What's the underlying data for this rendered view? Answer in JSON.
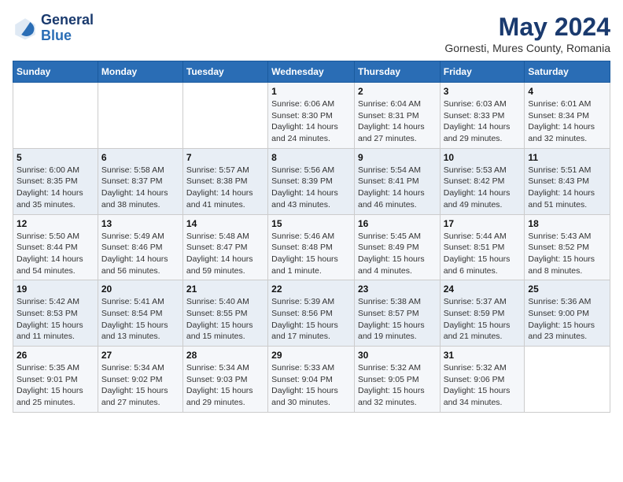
{
  "header": {
    "logo_line1": "General",
    "logo_line2": "Blue",
    "title": "May 2024",
    "subtitle": "Gornesti, Mures County, Romania"
  },
  "weekdays": [
    "Sunday",
    "Monday",
    "Tuesday",
    "Wednesday",
    "Thursday",
    "Friday",
    "Saturday"
  ],
  "weeks": [
    [
      {
        "day": "",
        "detail": ""
      },
      {
        "day": "",
        "detail": ""
      },
      {
        "day": "",
        "detail": ""
      },
      {
        "day": "1",
        "detail": "Sunrise: 6:06 AM\nSunset: 8:30 PM\nDaylight: 14 hours\nand 24 minutes."
      },
      {
        "day": "2",
        "detail": "Sunrise: 6:04 AM\nSunset: 8:31 PM\nDaylight: 14 hours\nand 27 minutes."
      },
      {
        "day": "3",
        "detail": "Sunrise: 6:03 AM\nSunset: 8:33 PM\nDaylight: 14 hours\nand 29 minutes."
      },
      {
        "day": "4",
        "detail": "Sunrise: 6:01 AM\nSunset: 8:34 PM\nDaylight: 14 hours\nand 32 minutes."
      }
    ],
    [
      {
        "day": "5",
        "detail": "Sunrise: 6:00 AM\nSunset: 8:35 PM\nDaylight: 14 hours\nand 35 minutes."
      },
      {
        "day": "6",
        "detail": "Sunrise: 5:58 AM\nSunset: 8:37 PM\nDaylight: 14 hours\nand 38 minutes."
      },
      {
        "day": "7",
        "detail": "Sunrise: 5:57 AM\nSunset: 8:38 PM\nDaylight: 14 hours\nand 41 minutes."
      },
      {
        "day": "8",
        "detail": "Sunrise: 5:56 AM\nSunset: 8:39 PM\nDaylight: 14 hours\nand 43 minutes."
      },
      {
        "day": "9",
        "detail": "Sunrise: 5:54 AM\nSunset: 8:41 PM\nDaylight: 14 hours\nand 46 minutes."
      },
      {
        "day": "10",
        "detail": "Sunrise: 5:53 AM\nSunset: 8:42 PM\nDaylight: 14 hours\nand 49 minutes."
      },
      {
        "day": "11",
        "detail": "Sunrise: 5:51 AM\nSunset: 8:43 PM\nDaylight: 14 hours\nand 51 minutes."
      }
    ],
    [
      {
        "day": "12",
        "detail": "Sunrise: 5:50 AM\nSunset: 8:44 PM\nDaylight: 14 hours\nand 54 minutes."
      },
      {
        "day": "13",
        "detail": "Sunrise: 5:49 AM\nSunset: 8:46 PM\nDaylight: 14 hours\nand 56 minutes."
      },
      {
        "day": "14",
        "detail": "Sunrise: 5:48 AM\nSunset: 8:47 PM\nDaylight: 14 hours\nand 59 minutes."
      },
      {
        "day": "15",
        "detail": "Sunrise: 5:46 AM\nSunset: 8:48 PM\nDaylight: 15 hours\nand 1 minute."
      },
      {
        "day": "16",
        "detail": "Sunrise: 5:45 AM\nSunset: 8:49 PM\nDaylight: 15 hours\nand 4 minutes."
      },
      {
        "day": "17",
        "detail": "Sunrise: 5:44 AM\nSunset: 8:51 PM\nDaylight: 15 hours\nand 6 minutes."
      },
      {
        "day": "18",
        "detail": "Sunrise: 5:43 AM\nSunset: 8:52 PM\nDaylight: 15 hours\nand 8 minutes."
      }
    ],
    [
      {
        "day": "19",
        "detail": "Sunrise: 5:42 AM\nSunset: 8:53 PM\nDaylight: 15 hours\nand 11 minutes."
      },
      {
        "day": "20",
        "detail": "Sunrise: 5:41 AM\nSunset: 8:54 PM\nDaylight: 15 hours\nand 13 minutes."
      },
      {
        "day": "21",
        "detail": "Sunrise: 5:40 AM\nSunset: 8:55 PM\nDaylight: 15 hours\nand 15 minutes."
      },
      {
        "day": "22",
        "detail": "Sunrise: 5:39 AM\nSunset: 8:56 PM\nDaylight: 15 hours\nand 17 minutes."
      },
      {
        "day": "23",
        "detail": "Sunrise: 5:38 AM\nSunset: 8:57 PM\nDaylight: 15 hours\nand 19 minutes."
      },
      {
        "day": "24",
        "detail": "Sunrise: 5:37 AM\nSunset: 8:59 PM\nDaylight: 15 hours\nand 21 minutes."
      },
      {
        "day": "25",
        "detail": "Sunrise: 5:36 AM\nSunset: 9:00 PM\nDaylight: 15 hours\nand 23 minutes."
      }
    ],
    [
      {
        "day": "26",
        "detail": "Sunrise: 5:35 AM\nSunset: 9:01 PM\nDaylight: 15 hours\nand 25 minutes."
      },
      {
        "day": "27",
        "detail": "Sunrise: 5:34 AM\nSunset: 9:02 PM\nDaylight: 15 hours\nand 27 minutes."
      },
      {
        "day": "28",
        "detail": "Sunrise: 5:34 AM\nSunset: 9:03 PM\nDaylight: 15 hours\nand 29 minutes."
      },
      {
        "day": "29",
        "detail": "Sunrise: 5:33 AM\nSunset: 9:04 PM\nDaylight: 15 hours\nand 30 minutes."
      },
      {
        "day": "30",
        "detail": "Sunrise: 5:32 AM\nSunset: 9:05 PM\nDaylight: 15 hours\nand 32 minutes."
      },
      {
        "day": "31",
        "detail": "Sunrise: 5:32 AM\nSunset: 9:06 PM\nDaylight: 15 hours\nand 34 minutes."
      },
      {
        "day": "",
        "detail": ""
      }
    ]
  ]
}
